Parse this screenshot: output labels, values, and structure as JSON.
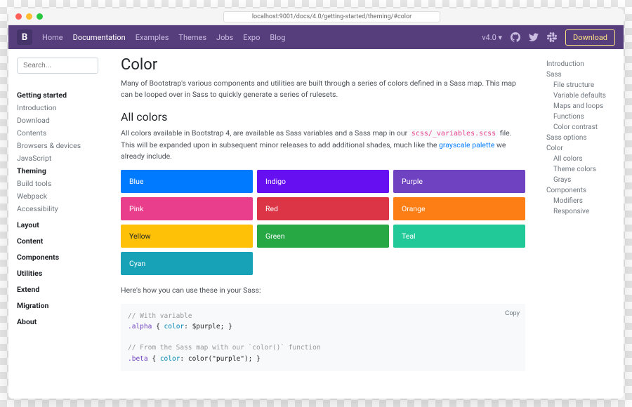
{
  "url": "localhost:9001/docs/4.0/getting-started/theming/#color",
  "logo": "B",
  "nav": [
    "Home",
    "Documentation",
    "Examples",
    "Themes",
    "Jobs",
    "Expo",
    "Blog"
  ],
  "nav_active": 1,
  "version": "v4.0",
  "download": "Download",
  "search_placeholder": "Search...",
  "sidebar_left": [
    {
      "head": "Getting started",
      "items": [
        "Introduction",
        "Download",
        "Contents",
        "Browsers & devices",
        "JavaScript",
        "Theming",
        "Build tools",
        "Webpack",
        "Accessibility"
      ],
      "active": 5
    },
    {
      "head": "Layout"
    },
    {
      "head": "Content"
    },
    {
      "head": "Components"
    },
    {
      "head": "Utilities"
    },
    {
      "head": "Extend"
    },
    {
      "head": "Migration"
    },
    {
      "head": "About"
    }
  ],
  "h1": "Color",
  "lead": "Many of Bootstrap's various components and utilities are built through a series of colors defined in a Sass map. This map can be looped over in Sass to quickly generate a series of rulesets.",
  "h2": "All colors",
  "p1_a": "All colors available in Bootstrap 4, are available as Sass variables and a Sass map in our ",
  "p1_code": "scss/_variables.scss",
  "p1_b": " file. This will be expanded upon in subsequent minor releases to add additional shades, much like the ",
  "p1_link": "grayscale palette",
  "p1_c": " we already include.",
  "swatches": [
    {
      "name": "Blue",
      "bg": "#007bff"
    },
    {
      "name": "Indigo",
      "bg": "#6610f2"
    },
    {
      "name": "Purple",
      "bg": "#6f42c1"
    },
    {
      "name": "Pink",
      "bg": "#e83e8c"
    },
    {
      "name": "Red",
      "bg": "#dc3545"
    },
    {
      "name": "Orange",
      "bg": "#fd7e14"
    },
    {
      "name": "Yellow",
      "bg": "#ffc107",
      "dark": true
    },
    {
      "name": "Green",
      "bg": "#28a745"
    },
    {
      "name": "Teal",
      "bg": "#20c997"
    },
    {
      "name": "Cyan",
      "bg": "#17a2b8"
    }
  ],
  "p2": "Here's how you can use these in your Sass:",
  "copy": "Copy",
  "code": {
    "c1": "// With variable",
    "l1a": ".alpha",
    "l1b": "{",
    "l1c": "color",
    "l1d": ": $purple;",
    "l1e": "}",
    "c2": "// From the Sass map with our `color()` function",
    "l2a": ".beta",
    "l2b": "{",
    "l2c": "color",
    "l2d": ": color(\"purple\");",
    "l2e": "}"
  },
  "sidebar_right": [
    {
      "label": "Introduction"
    },
    {
      "label": "Sass"
    },
    {
      "label": "File structure",
      "sub": true
    },
    {
      "label": "Variable defaults",
      "sub": true
    },
    {
      "label": "Maps and loops",
      "sub": true
    },
    {
      "label": "Functions",
      "sub": true
    },
    {
      "label": "Color contrast",
      "sub": true
    },
    {
      "label": "Sass options"
    },
    {
      "label": "Color"
    },
    {
      "label": "All colors",
      "sub": true
    },
    {
      "label": "Theme colors",
      "sub": true
    },
    {
      "label": "Grays",
      "sub": true
    },
    {
      "label": "Components"
    },
    {
      "label": "Modifiers",
      "sub": true
    },
    {
      "label": "Responsive",
      "sub": true
    }
  ]
}
